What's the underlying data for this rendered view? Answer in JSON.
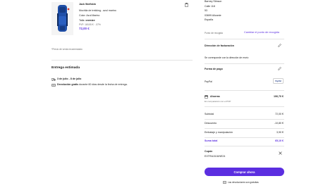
{
  "product": {
    "brand": "Jack Wolfskin",
    "name": "Mochila de trekking - azul marino",
    "color_line": "Color: Azul Marino",
    "size_label": "Talla: ",
    "size_value": "onesize",
    "rrp_line": "PVP: 169,95 € · -57%",
    "price": "72,00 €",
    "footnote": "*Precio de venta recomendado",
    "icon": "trash-icon"
  },
  "delivery": {
    "title": "Entrega estimada",
    "date": "3 de julio - 8 de julio",
    "returns_bold": "Devolución gratis",
    "returns_rest": " durante 60 días desde la fecha de entrega."
  },
  "address": {
    "lines": [
      "Barney Stinson",
      "Calle 118",
      "53",
      "03699 Alicante",
      "España"
    ],
    "pickup_label": "Punto de recogida",
    "change_link": "Cambiar el punto de recogida"
  },
  "billing": {
    "title": "Dirección de facturación",
    "text": "Se corresponde con la dirección de envío"
  },
  "payment": {
    "title": "Forma de pago",
    "method": "PayPal",
    "logo_text": "PayPal"
  },
  "savings": {
    "label": "Ahorras",
    "amount": "106,70 €",
    "sub": "En comparación con el PVP"
  },
  "summary": {
    "rows": [
      {
        "label": "Subtotal",
        "value": "72,00 €"
      },
      {
        "label": "Descuento",
        "value": "-10,80 €"
      },
      {
        "label": "Embalaje y manipulación",
        "value": "3,90 €"
      }
    ],
    "total_label": "Suma total",
    "total_value": "65,10 €"
  },
  "coupon": {
    "label": "Cupón",
    "code": "EXTRA15JUNE24"
  },
  "cta": {
    "buy_label": "Comprar ahora",
    "returns_note": "Las devoluciones son gratuitas"
  },
  "colors": {
    "accent": "#5b2ee0",
    "backpack": "#1f4fa8"
  }
}
